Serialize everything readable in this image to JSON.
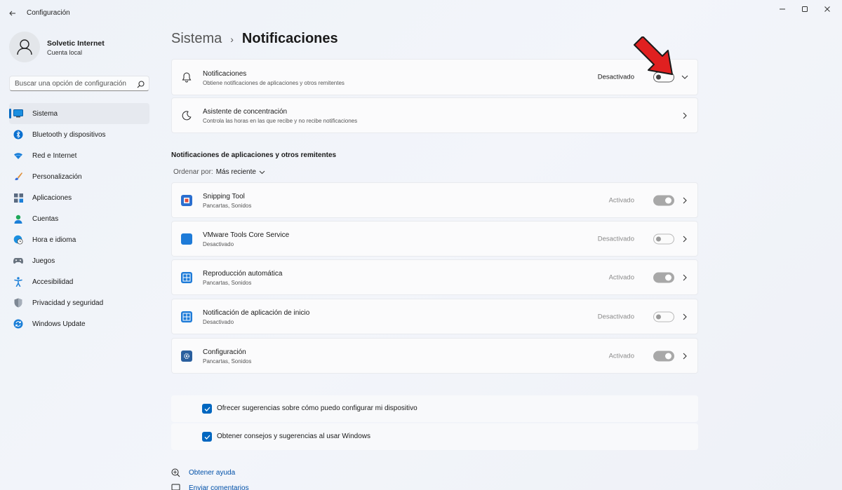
{
  "window": {
    "title": "Configuración"
  },
  "profile": {
    "name": "Solvetic Internet",
    "account": "Cuenta local"
  },
  "search": {
    "placeholder": "Buscar una opción de configuración"
  },
  "sidebar": {
    "items": [
      {
        "label": "Sistema",
        "icon": "system-icon",
        "active": true
      },
      {
        "label": "Bluetooth y dispositivos",
        "icon": "bluetooth-icon"
      },
      {
        "label": "Red e Internet",
        "icon": "wifi-icon"
      },
      {
        "label": "Personalización",
        "icon": "brush-icon"
      },
      {
        "label": "Aplicaciones",
        "icon": "apps-icon"
      },
      {
        "label": "Cuentas",
        "icon": "person-icon"
      },
      {
        "label": "Hora e idioma",
        "icon": "globe-clock-icon"
      },
      {
        "label": "Juegos",
        "icon": "gamepad-icon"
      },
      {
        "label": "Accesibilidad",
        "icon": "accessibility-icon"
      },
      {
        "label": "Privacidad y seguridad",
        "icon": "shield-icon"
      },
      {
        "label": "Windows Update",
        "icon": "update-icon"
      }
    ]
  },
  "breadcrumb": {
    "parent": "Sistema",
    "separator": "›",
    "current": "Notificaciones"
  },
  "notifications_card": {
    "title": "Notificaciones",
    "subtitle": "Obtiene notificaciones de aplicaciones y otros remitentes",
    "state": "Desactivado",
    "enabled": false
  },
  "focus_card": {
    "title": "Asistente de concentración",
    "subtitle": "Controla las horas en las que recibe y no recibe notificaciones"
  },
  "apps_section": {
    "heading": "Notificaciones de aplicaciones y otros remitentes",
    "sort_label": "Ordenar por:",
    "sort_value": "Más reciente",
    "apps": [
      {
        "name": "Snipping Tool",
        "detail": "Pancartas, Sonidos",
        "state": "Activado",
        "enabled": true,
        "icon": "snipping-tool-icon"
      },
      {
        "name": "VMware Tools Core Service",
        "detail": "Desactivado",
        "state": "Desactivado",
        "enabled": false,
        "icon": "vmware-icon"
      },
      {
        "name": "Reproducción automática",
        "detail": "Pancartas, Sonidos",
        "state": "Activado",
        "enabled": true,
        "icon": "autoplay-icon"
      },
      {
        "name": "Notificación de aplicación de inicio",
        "detail": "Desactivado",
        "state": "Desactivado",
        "enabled": false,
        "icon": "startup-app-icon"
      },
      {
        "name": "Configuración",
        "detail": "Pancartas, Sonidos",
        "state": "Activado",
        "enabled": true,
        "icon": "settings-gear-icon"
      }
    ]
  },
  "checkboxes": [
    {
      "label": "Ofrecer sugerencias sobre cómo puedo configurar mi dispositivo",
      "checked": true
    },
    {
      "label": "Obtener consejos y sugerencias al usar Windows",
      "checked": true
    }
  ],
  "footer": {
    "help": "Obtener ayuda",
    "feedback": "Enviar comentarios"
  },
  "colors": {
    "accent": "#0067c0",
    "annotation_arrow": "#e02020"
  }
}
